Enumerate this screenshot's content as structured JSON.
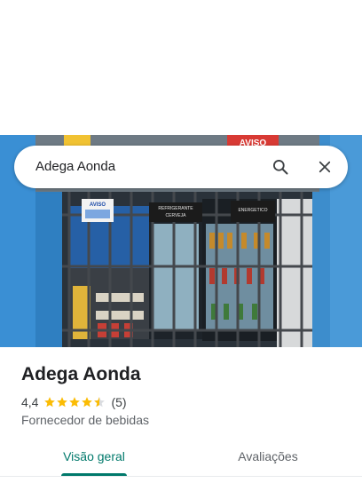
{
  "search": {
    "query": "Adega Aonda",
    "search_icon": "search-icon",
    "close_icon": "close-icon"
  },
  "hero": {
    "description_icon": "storefront-photo",
    "sign_aviso": "AVISO",
    "sign_refrigerante": "REFRIGERANTE",
    "sign_cerveja": "CERVEJA",
    "sign_energetico": "ENERGETICO"
  },
  "place": {
    "name": "Adega Aonda",
    "rating": "4,4",
    "rating_numeric": 4.4,
    "stars_max": 5,
    "review_count": "(5)",
    "category": "Fornecedor de bebidas"
  },
  "tabs": [
    {
      "label": "Visão geral",
      "active": true
    },
    {
      "label": "Avaliações",
      "active": false
    }
  ],
  "colors": {
    "accent": "#00796b",
    "star": "#fbbc04",
    "text_primary": "#202124",
    "text_secondary": "#5f6368"
  }
}
